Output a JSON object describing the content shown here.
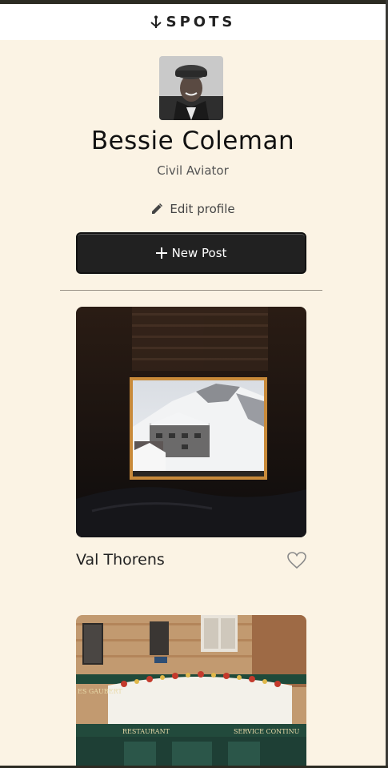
{
  "header": {
    "logo_text": "SPOTS"
  },
  "profile": {
    "name": "Bessie Coleman",
    "role": "Civil Aviator",
    "edit_label": "Edit profile",
    "new_post_label": "New Post"
  },
  "posts": [
    {
      "title": "Val Thorens",
      "liked": false
    },
    {
      "title": ""
    }
  ],
  "colors": {
    "background": "#fbf3e4",
    "button": "#212121",
    "text": "#212121"
  },
  "icons": [
    "logo-mark-icon",
    "pencil-icon",
    "plus-icon",
    "heart-icon"
  ]
}
